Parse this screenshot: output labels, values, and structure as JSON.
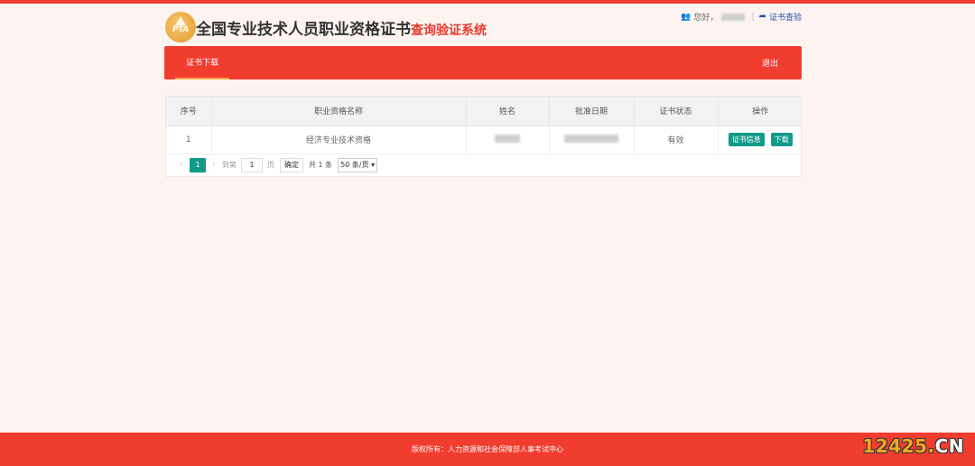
{
  "header": {
    "logo_text": "PTA",
    "title_main": "全国专业技术人员职业资格证书",
    "title_highlight": "查询验证系统",
    "greeting": "您好，",
    "user_name_redacted": "",
    "separator": "|",
    "verify_link": "证书查验"
  },
  "nav": {
    "tab_download": "证书下载",
    "logout": "退出"
  },
  "table": {
    "headers": [
      "序号",
      "职业资格名称",
      "姓名",
      "批准日期",
      "证书状态",
      "操作"
    ],
    "rows": [
      {
        "index": "1",
        "qualification": "经济专业技术资格",
        "status": "有效",
        "action_info": "证书信息",
        "action_download": "下载"
      }
    ]
  },
  "pager": {
    "prev": "‹",
    "current_page": "1",
    "next": "›",
    "goto_label": "到第",
    "goto_value": "1",
    "page_unit": "页",
    "confirm": "确定",
    "total": "共 1 条",
    "page_size": "50 条/页"
  },
  "footer": {
    "copyright": "版权所有：人力资源和社会保障部人事考试中心"
  },
  "watermark": {
    "main": "12425.",
    "suffix": "CN"
  },
  "colors": {
    "brand_red": "#f03d30",
    "teal": "#129a8a",
    "page_bg": "#fdf4f1"
  }
}
